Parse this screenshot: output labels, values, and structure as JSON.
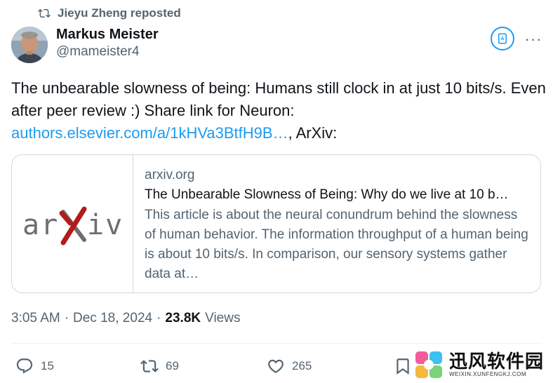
{
  "repost": {
    "label": "Jieyu Zheng reposted",
    "icon": "repost-icon"
  },
  "author": {
    "name": "Markus Meister",
    "handle": "@mameister4",
    "avatar_icon": "avatar"
  },
  "header_actions": {
    "grok_icon": "grok-icon",
    "more_icon": "more-icon",
    "more_label": "···"
  },
  "tweet": {
    "text_part1": "The unbearable slowness of being: Humans still clock in at just 10 bits/s. Even after peer review :) Share link for Neuron: ",
    "link_text": "authors.elsevier.com/a/1kHVa3BtfH9B…",
    "text_part2": ", ArXiv:"
  },
  "card": {
    "thumbnail_logo": "arXiv",
    "domain": "arxiv.org",
    "title": "The Unbearable Slowness of Being: Why do we live at 10 b…",
    "description": "This article is about the neural conundrum behind the slowness of human behavior. The information throughput of a human being is about 10 bits/s. In comparison, our sensory systems gather data at…"
  },
  "meta": {
    "time": "3:05 AM",
    "separator": "·",
    "date": "Dec 18, 2024",
    "views_count": "23.8K",
    "views_label": "Views"
  },
  "actions": {
    "reply_count": "15",
    "retweet_count": "69",
    "like_count": "265"
  },
  "watermark": {
    "main": "迅风软件园",
    "sub": "WEIXIN.XUNFENGKJ.COM"
  },
  "colors": {
    "accent": "#1d9bf0",
    "text": "#0f1419",
    "secondary": "#536471",
    "border": "#cfd9de",
    "arxiv_red": "#b31b1b",
    "arxiv_gray": "#5c5c5c"
  }
}
